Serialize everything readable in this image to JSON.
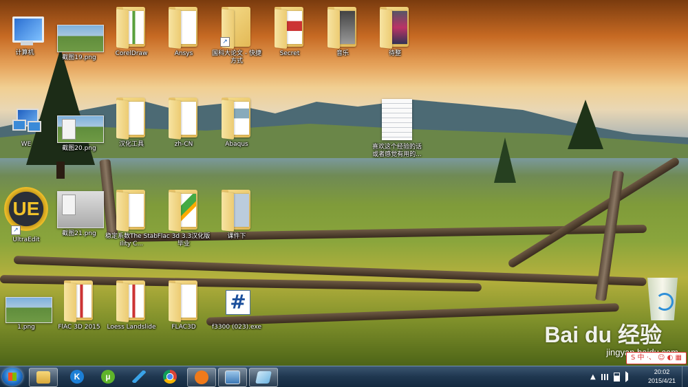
{
  "desktop": {
    "icons": [
      {
        "label": "计算机"
      },
      {
        "label": "截图19.png"
      },
      {
        "label": "CorelDraw"
      },
      {
        "label": "Ansys"
      },
      {
        "label": "国科大论文 - 快捷方式"
      },
      {
        "label": "Secret"
      },
      {
        "label": "音乐"
      },
      {
        "label": "待整"
      },
      {
        "label": "WE"
      },
      {
        "label": "截图20.png"
      },
      {
        "label": "汉化工具"
      },
      {
        "label": "zh-CN"
      },
      {
        "label": "Abaqus"
      },
      {
        "label": "喜欢这个经验的话或者感觉有用的..."
      },
      {
        "label": "UltraEdit"
      },
      {
        "label": "截图21.png"
      },
      {
        "label": "稳定系数The Stability C..."
      },
      {
        "label": "Flac 3d 3.3汉化版 毕业"
      },
      {
        "label": "课件下"
      },
      {
        "label": "1.png"
      },
      {
        "label": "FlAC 3D 2015"
      },
      {
        "label": "Loess Landslide"
      },
      {
        "label": "FLAC3D"
      },
      {
        "label": "f3300 (023).exe"
      },
      {
        "label": ""
      }
    ],
    "watermark": {
      "brand": "Bai du 经验",
      "url": "jingyan.baidu.com"
    },
    "ime_bar": "S 中 ·、 ☺ ◐ ▦"
  },
  "taskbar": {
    "apps": [
      {
        "icon": "file-explorer-icon"
      },
      {
        "icon": "kugou-music-icon"
      },
      {
        "icon": "utorrent-icon"
      },
      {
        "icon": "feiq-bird-icon"
      },
      {
        "icon": "chrome-icon"
      },
      {
        "icon": "uc-browser-icon"
      },
      {
        "icon": "window-app-icon"
      },
      {
        "icon": "notes-app-icon"
      }
    ],
    "tray_arrow": "▲",
    "clock": {
      "time": "20:02",
      "date": "2015/4/21"
    }
  }
}
